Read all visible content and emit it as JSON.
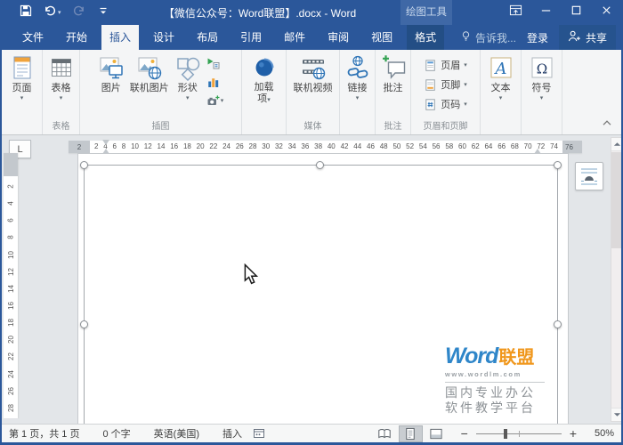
{
  "titlebar": {
    "title": "【微信公众号：Word联盟】.docx - Word",
    "contextual_header": "绘图工具",
    "qat": [
      {
        "name": "save-button",
        "icon": "save-icon"
      },
      {
        "name": "undo-button",
        "icon": "undo-icon",
        "dropdown": true
      },
      {
        "name": "redo-button",
        "icon": "redo-icon",
        "disabled": true
      },
      {
        "name": "qat-customize-button",
        "icon": "qat-customize-icon"
      }
    ],
    "window_buttons": [
      {
        "name": "ribbon-display-options-button",
        "icon": "ribbon-display-icon"
      },
      {
        "name": "minimize-button",
        "icon": "minimize-icon"
      },
      {
        "name": "maximize-button",
        "icon": "maximize-icon"
      },
      {
        "name": "close-button",
        "icon": "close-icon"
      }
    ]
  },
  "tabs": [
    {
      "id": "file",
      "label": "文件"
    },
    {
      "id": "home",
      "label": "开始"
    },
    {
      "id": "insert",
      "label": "插入",
      "active": true
    },
    {
      "id": "design",
      "label": "设计"
    },
    {
      "id": "layout",
      "label": "布局"
    },
    {
      "id": "references",
      "label": "引用"
    },
    {
      "id": "mailings",
      "label": "邮件"
    },
    {
      "id": "review",
      "label": "审阅"
    },
    {
      "id": "view",
      "label": "视图"
    },
    {
      "id": "format",
      "label": "格式",
      "contextual": true
    }
  ],
  "tab_extras": {
    "tell_me": "告诉我...",
    "sign_in": "登录",
    "share": "共享"
  },
  "ribbon": {
    "groups": [
      {
        "name": "pages-group",
        "label": "",
        "buttons": [
          {
            "kind": "large",
            "name": "pages-button",
            "label": "页面",
            "icon": "pages-icon",
            "dropdown": true
          }
        ]
      },
      {
        "name": "tables-group",
        "label": "表格",
        "buttons": [
          {
            "kind": "large",
            "name": "table-button",
            "label": "表格",
            "icon": "table-icon",
            "dropdown": true
          }
        ]
      },
      {
        "name": "illustrations-group",
        "label": "插图",
        "buttons": [
          {
            "kind": "large",
            "name": "pictures-button",
            "label": "图片",
            "icon": "picture-icon"
          },
          {
            "kind": "large",
            "name": "online-pictures-button",
            "label": "联机图片",
            "icon": "online-picture-icon"
          },
          {
            "kind": "large",
            "name": "shapes-button",
            "label": "形状",
            "icon": "shapes-icon",
            "dropdown": true
          },
          {
            "kind": "icon-stack",
            "name": "illustrations-mini-stack",
            "items": [
              {
                "name": "smartart-button",
                "icon": "smartart-icon"
              },
              {
                "name": "chart-button",
                "icon": "chart-icon"
              },
              {
                "name": "screenshot-button",
                "icon": "screenshot-icon",
                "dropdown": true
              }
            ]
          }
        ]
      },
      {
        "name": "addins-group",
        "label": "",
        "buttons": [
          {
            "kind": "large",
            "name": "addins-button",
            "label": "加载项",
            "icon": "addins-icon",
            "dropdown": true,
            "wrap": true
          }
        ]
      },
      {
        "name": "media-group",
        "label": "媒体",
        "buttons": [
          {
            "kind": "large",
            "name": "online-video-button",
            "label": "联机视频",
            "icon": "online-video-icon"
          }
        ]
      },
      {
        "name": "links-group",
        "label": "",
        "buttons": [
          {
            "kind": "large",
            "name": "link-button",
            "label": "链接",
            "icon": "link-icon",
            "dropdown": true
          }
        ]
      },
      {
        "name": "comments-group",
        "label": "批注",
        "buttons": [
          {
            "kind": "large",
            "name": "new-comment-button",
            "label": "批注",
            "icon": "comment-icon"
          }
        ]
      },
      {
        "name": "header-footer-group",
        "label": "页眉和页脚",
        "buttons": [
          {
            "kind": "menu-stack",
            "name": "header-footer-stack",
            "items": [
              {
                "name": "header-button",
                "label": "页眉",
                "icon": "header-icon",
                "dropdown": true
              },
              {
                "name": "footer-button",
                "label": "页脚",
                "icon": "footer-icon",
                "dropdown": true
              },
              {
                "name": "page-number-button",
                "label": "页码",
                "icon": "pagenum-icon",
                "dropdown": true
              }
            ]
          }
        ]
      },
      {
        "name": "text-group",
        "label": "",
        "buttons": [
          {
            "kind": "large",
            "name": "text-button",
            "label": "文本",
            "icon": "text-icon",
            "dropdown": true
          }
        ]
      },
      {
        "name": "symbols-group",
        "label": "",
        "buttons": [
          {
            "kind": "large",
            "name": "symbol-button",
            "label": "符号",
            "icon": "symbol-icon",
            "dropdown": true
          }
        ]
      }
    ]
  },
  "ruler": {
    "tab_selector": "L",
    "h_margin_left": "2",
    "h_margin_right": "76",
    "h_numbers": [
      2,
      4,
      6,
      8,
      10,
      12,
      14,
      16,
      18,
      20,
      22,
      24,
      26,
      28,
      30,
      32,
      34,
      36,
      38,
      40,
      42,
      44,
      46,
      48,
      50,
      52,
      54,
      56,
      58,
      60,
      62,
      64,
      66,
      68,
      70,
      72,
      74
    ],
    "v_numbers": [
      2,
      4,
      6,
      8,
      10,
      12,
      14,
      16,
      18,
      20,
      22,
      24,
      26,
      28
    ]
  },
  "logo": {
    "brand_en": "Word",
    "brand_cn": "联盟",
    "url": "www.wordlm.com",
    "tagline1": "国内专业办公",
    "tagline2": "软件教学平台"
  },
  "status": {
    "page_info": "第 1 页，共 1 页",
    "word_count": "0 个字",
    "language": "英语(美国)",
    "input_mode": "插入",
    "zoom_out": "−",
    "zoom_in": "+",
    "zoom_level": "50%"
  },
  "colors": {
    "titlebar_blue": "#2b579a",
    "contextual_tab_blue": "#3f68a6",
    "format_tab_blue": "#234e85",
    "brand_blue": "#2f86c9",
    "accent_orange": "#f0971c"
  }
}
